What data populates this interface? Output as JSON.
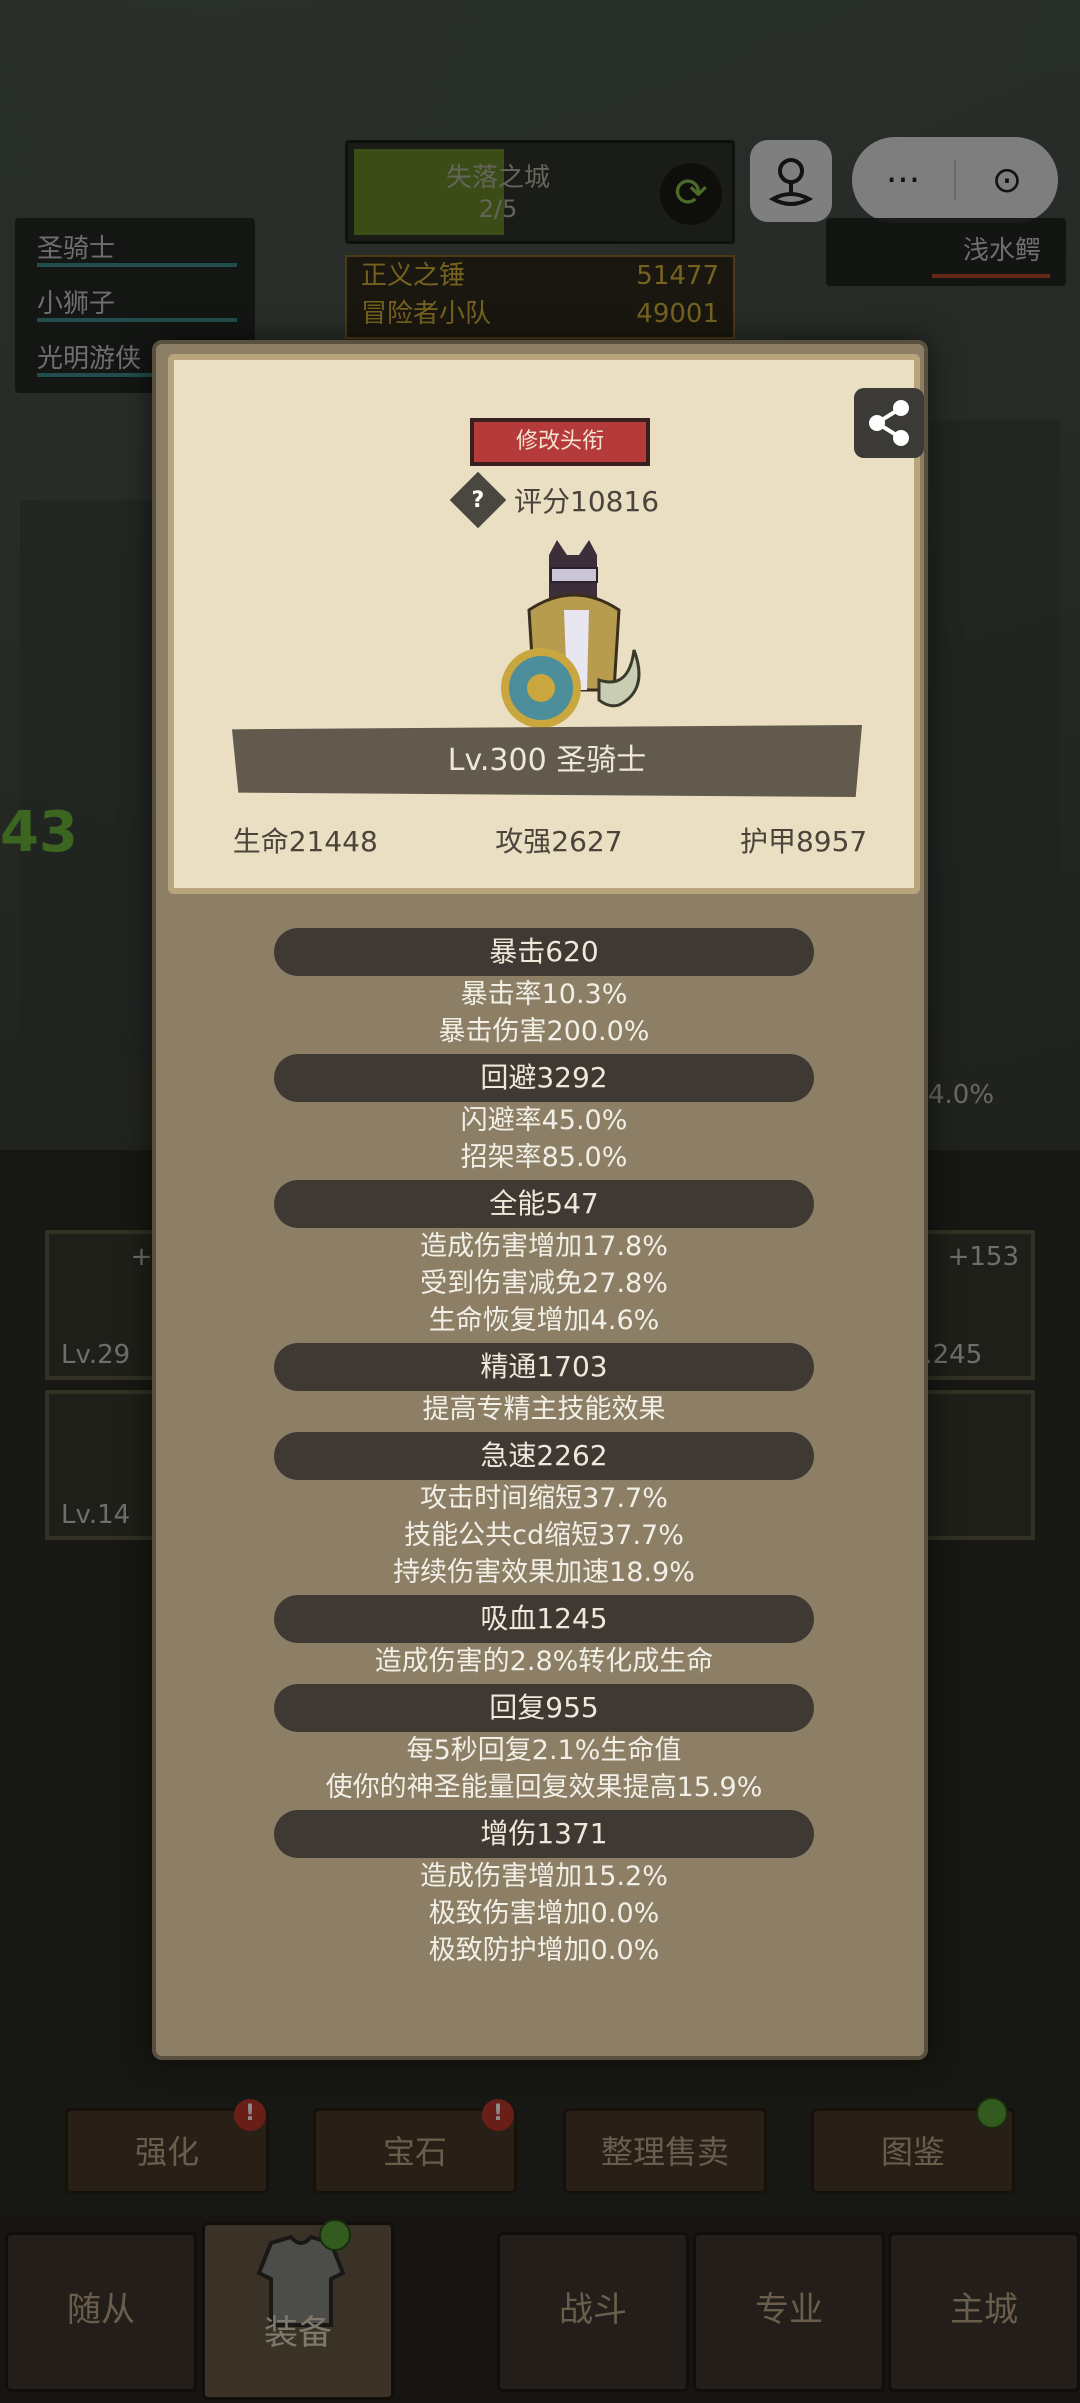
{
  "hud": {
    "stage_name": "失落之城",
    "stage_progress": "2/5",
    "party": [
      "圣骑士",
      "小狮子",
      "光明游侠"
    ],
    "ranks": [
      {
        "name": "正义之锤",
        "value": "51477"
      },
      {
        "name": "冒险者小队",
        "value": "49001"
      }
    ],
    "enemy_name": "浅水鳄",
    "wx_more": "···",
    "wx_close": "⊙"
  },
  "side": {
    "left_number": "43",
    "right_percent": "4.0%",
    "slots": [
      {
        "lv": "Lv.29",
        "plus": "+1"
      },
      {
        "lv": "Lv.14",
        "plus": ""
      },
      {
        "lv": "v.245",
        "plus": "+153"
      }
    ]
  },
  "actions": [
    {
      "label": "强化",
      "badge": "!"
    },
    {
      "label": "宝石",
      "badge": "!"
    },
    {
      "label": "整理售卖",
      "badge": ""
    },
    {
      "label": "图鉴",
      "badge": ""
    }
  ],
  "nav": {
    "tabs": [
      "随从",
      "装备",
      "战斗",
      "专业",
      "主城"
    ]
  },
  "modal": {
    "title_button": "修改头衔",
    "score": "评分10816",
    "help": "?",
    "hero_name": "Lv.300 圣骑士",
    "stats": [
      "生命21448",
      "攻强2627",
      "护甲8957"
    ],
    "attributes": [
      {
        "head": "暴击620",
        "lines": [
          "暴击率10.3%",
          "暴击伤害200.0%"
        ]
      },
      {
        "head": "回避3292",
        "lines": [
          "闪避率45.0%",
          "招架率85.0%"
        ]
      },
      {
        "head": "全能547",
        "lines": [
          "造成伤害增加17.8%",
          "受到伤害减免27.8%",
          "生命恢复增加4.6%"
        ]
      },
      {
        "head": "精通1703",
        "lines": [
          "提高专精主技能效果"
        ]
      },
      {
        "head": "急速2262",
        "lines": [
          "攻击时间缩短37.7%",
          "技能公共cd缩短37.7%",
          "持续伤害效果加速18.9%"
        ]
      },
      {
        "head": "吸血1245",
        "lines": [
          "造成伤害的2.8%转化成生命"
        ]
      },
      {
        "head": "回复955",
        "lines": [
          "每5秒回复2.1%生命值",
          "使你的神圣能量回复效果提高15.9%"
        ]
      },
      {
        "head": "增伤1371",
        "lines": [
          "造成伤害增加15.2%",
          "极致伤害增加0.0%",
          "极致防护增加0.0%"
        ]
      }
    ]
  }
}
